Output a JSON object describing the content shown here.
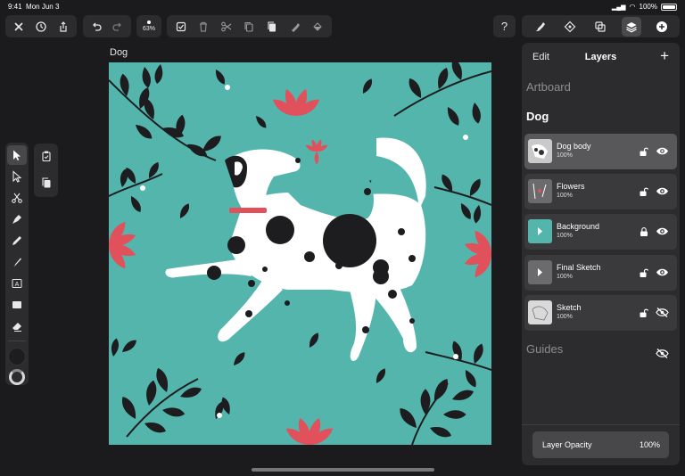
{
  "status": {
    "time": "9:41",
    "date": "Mon Jun 3",
    "battery": "100%"
  },
  "toolbar": {
    "zoom": "63%",
    "icons_left": [
      "close-icon",
      "history-icon",
      "share-icon"
    ],
    "icons_undo": [
      "undo-icon",
      "redo-icon"
    ],
    "icons_edit": [
      "select-all-icon",
      "trash-icon",
      "cut-icon",
      "copy-icon",
      "paste-icon",
      "paint-icon",
      "fill-icon"
    ],
    "help": "?"
  },
  "document": {
    "title": "Dog"
  },
  "panel": {
    "edit_label": "Edit",
    "title": "Layers",
    "add_label": "+",
    "artboard_label": "Artboard",
    "group_label": "Dog",
    "layers": [
      {
        "name": "Dog body",
        "opacity": "100%",
        "selected": true,
        "locked": false,
        "visible": true
      },
      {
        "name": "Flowers",
        "opacity": "100%",
        "selected": false,
        "locked": false,
        "visible": true
      },
      {
        "name": "Background",
        "opacity": "100%",
        "selected": false,
        "locked": true,
        "visible": true
      },
      {
        "name": "Final Sketch",
        "opacity": "100%",
        "selected": false,
        "locked": false,
        "visible": true
      },
      {
        "name": "Sketch",
        "opacity": "100%",
        "selected": false,
        "locked": false,
        "visible": false
      }
    ],
    "guides_label": "Guides",
    "layer_opacity_label": "Layer Opacity",
    "layer_opacity_value": "100%"
  },
  "colors": {
    "canvas_bg": "#54b5ad",
    "leaf": "#1d1d1f",
    "flower": "#e0515c",
    "dog": "#ffffff"
  }
}
